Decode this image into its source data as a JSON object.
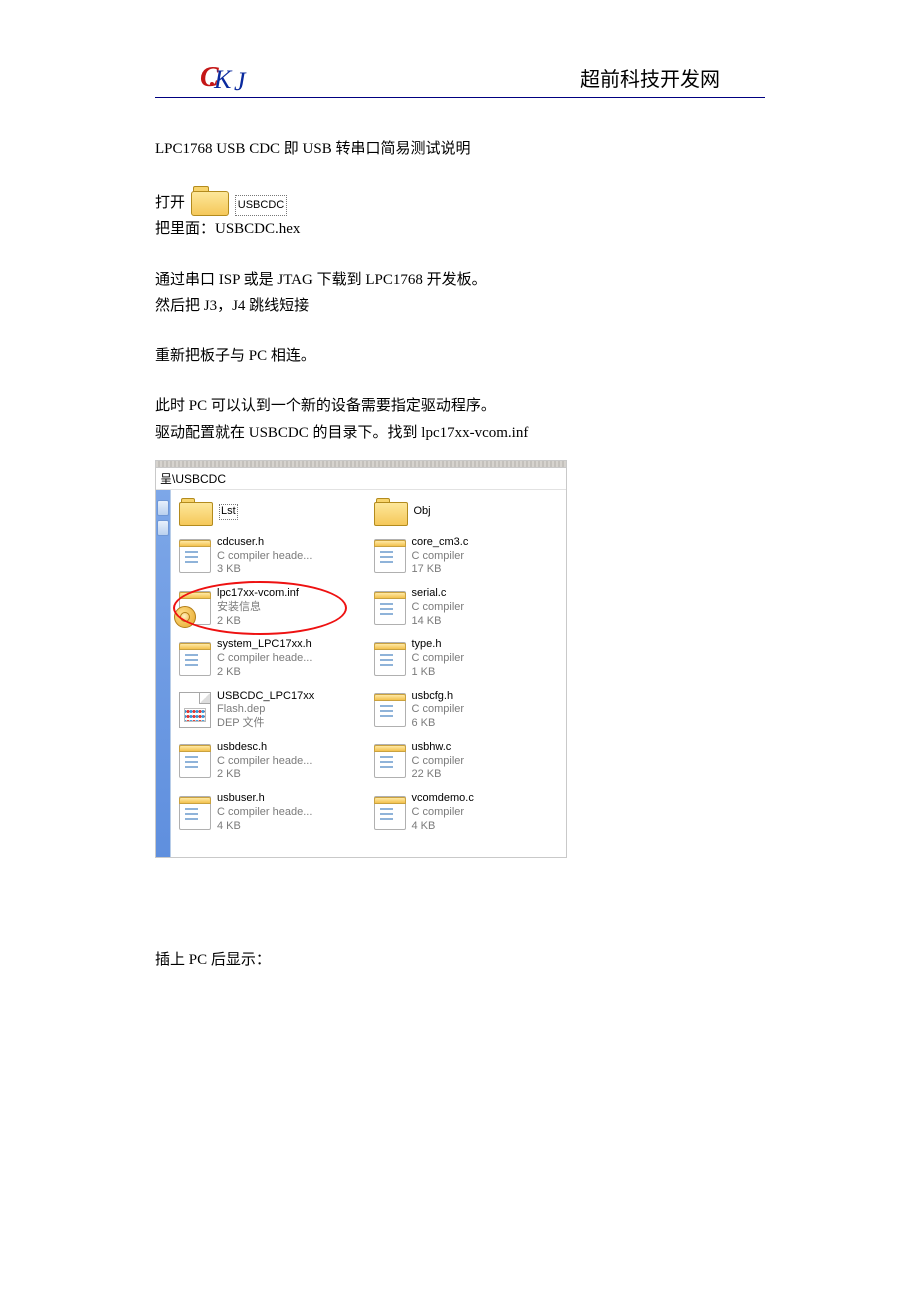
{
  "header": {
    "logo_letters": {
      "c": "C",
      "k": "K",
      "j": "J"
    },
    "site_title": "超前科技开发网"
  },
  "article": {
    "title": "LPC1768   USB CDC 即 USB 转串口简易测试说明",
    "open_label": "打开",
    "folder_inline_label": "USBCDC",
    "hex_line": "把里面：USBCDC.hex",
    "p1a": "通过串口 ISP 或是 JTAG 下载到 LPC1768 开发板。",
    "p1b": "然后把 J3，J4 跳线短接",
    "p2": "重新把板子与 PC 相连。",
    "p3a": "此时 PC 可以认到一个新的设备需要指定驱动程序。",
    "p3b": "驱动配置就在 USBCDC 的目录下。找到 lpc17xx-vcom.inf",
    "footer": "插上 PC 后显示："
  },
  "explorer": {
    "address": "呈\\USBCDC",
    "items": [
      {
        "icon": "folder",
        "name": "Lst",
        "meta1": "",
        "meta2": "",
        "dotted": true
      },
      {
        "icon": "folder",
        "name": "Obj",
        "meta1": "",
        "meta2": ""
      },
      {
        "icon": "note",
        "name": "cdcuser.h",
        "meta1": "C compiler heade...",
        "meta2": "3 KB"
      },
      {
        "icon": "note",
        "name": "core_cm3.c",
        "meta1": "C compiler",
        "meta2": "17 KB"
      },
      {
        "icon": "inf",
        "name": "lpc17xx-vcom.inf",
        "meta1": "安装信息",
        "meta2": "2 KB",
        "circled": true
      },
      {
        "icon": "note",
        "name": "serial.c",
        "meta1": "C compiler",
        "meta2": "14 KB"
      },
      {
        "icon": "note",
        "name": "system_LPC17xx.h",
        "meta1": "C compiler heade...",
        "meta2": "2 KB"
      },
      {
        "icon": "note",
        "name": "type.h",
        "meta1": "C compiler",
        "meta2": "1 KB"
      },
      {
        "icon": "dep",
        "name": "USBCDC_LPC17xx",
        "meta1": "Flash.dep",
        "meta2": "DEP 文件"
      },
      {
        "icon": "note",
        "name": "usbcfg.h",
        "meta1": "C compiler",
        "meta2": "6 KB"
      },
      {
        "icon": "note",
        "name": "usbdesc.h",
        "meta1": "C compiler heade...",
        "meta2": "2 KB"
      },
      {
        "icon": "note",
        "name": "usbhw.c",
        "meta1": "C compiler",
        "meta2": "22 KB"
      },
      {
        "icon": "note",
        "name": "usbuser.h",
        "meta1": "C compiler heade...",
        "meta2": "4 KB"
      },
      {
        "icon": "note",
        "name": "vcomdemo.c",
        "meta1": "C compiler",
        "meta2": "4 KB"
      }
    ]
  }
}
